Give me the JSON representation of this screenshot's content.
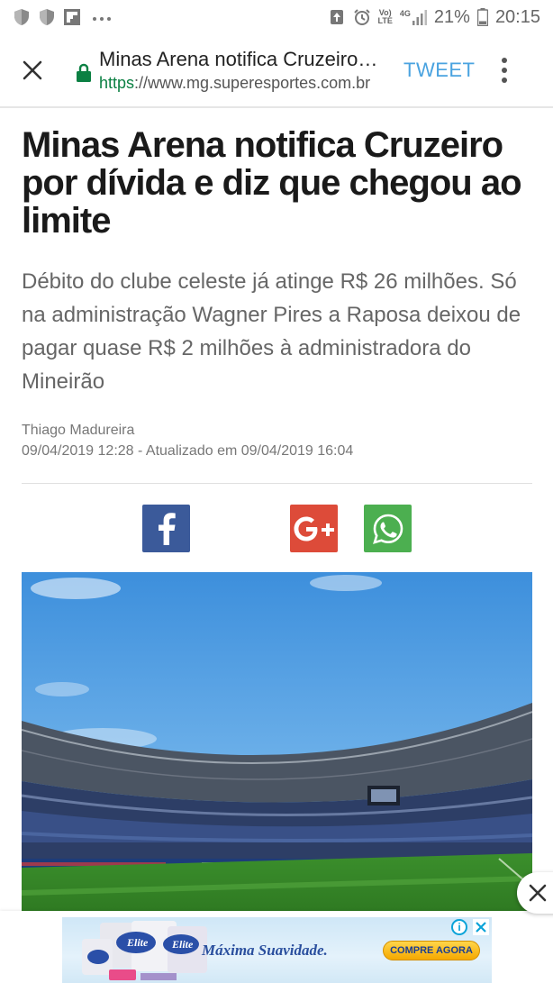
{
  "status_bar": {
    "network_label_top": "Vo)",
    "network_label_bottom": "LTE",
    "signal_label": "4G",
    "battery": "21%",
    "time": "20:15"
  },
  "toolbar": {
    "title": "Minas Arena notifica Cruzeiro por dívida e diz que chegou ao limite",
    "url_scheme": "https",
    "url_rest": "://www.mg.superesportes.com.br",
    "tweet_label": "TWEET"
  },
  "article": {
    "headline": "Minas Arena notifica Cruzeiro por dívida e diz que chegou ao limite",
    "subtitle": "Débito do clube celeste já atinge R$ 26 milhões. Só na administração Wagner Pires a Raposa deixou de pagar quase R$ 2 milhões à administradora do Mineirão",
    "author": "Thiago Madureira",
    "dateline": "09/04/2019 12:28 - Atualizado em 09/04/2019 16:04"
  },
  "share": {
    "facebook_icon": "facebook-icon",
    "googleplus_icon": "google-plus-icon",
    "whatsapp_icon": "whatsapp-icon",
    "colors": {
      "facebook": "#3b5a9a",
      "googleplus": "#dd4b39",
      "whatsapp": "#4caf50"
    }
  },
  "ad": {
    "brand": "Elite",
    "tagline": "Máxima Suavidade.",
    "cta": "COMPRE AGORA"
  }
}
